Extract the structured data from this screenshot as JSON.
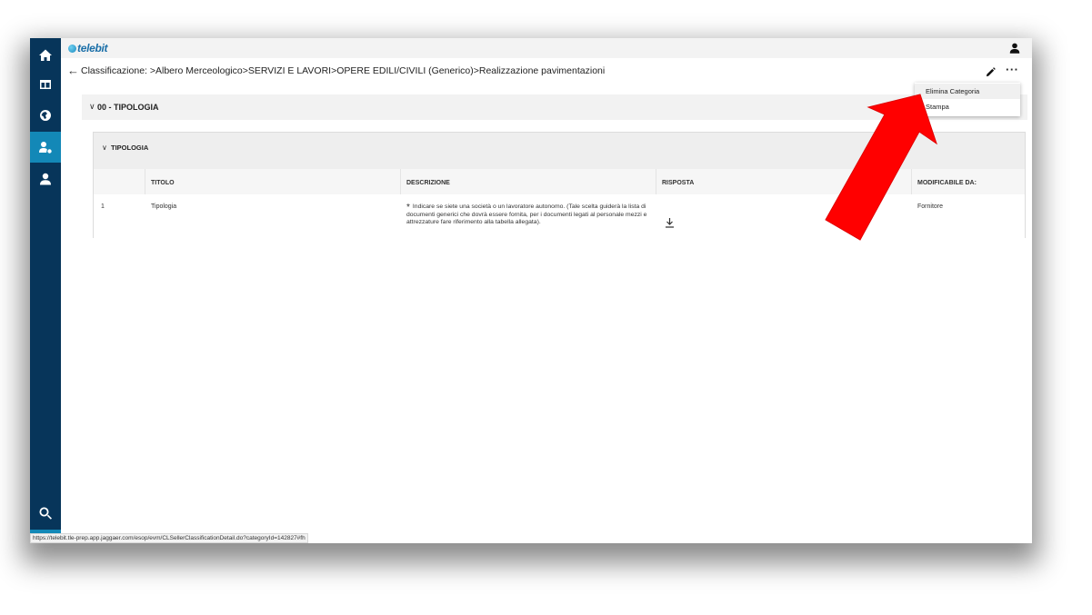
{
  "app": {
    "logo_text": "telebit"
  },
  "sidebar": {
    "items": [
      {
        "name": "home",
        "icon": "home-icon"
      },
      {
        "name": "dashboard",
        "icon": "layout-icon"
      },
      {
        "name": "globe",
        "icon": "globe-icon"
      },
      {
        "name": "supplier",
        "icon": "user-settings-icon",
        "active": true
      },
      {
        "name": "profile",
        "icon": "user-icon"
      },
      {
        "name": "search",
        "icon": "search-icon"
      }
    ]
  },
  "breadcrumb": {
    "text": "Classificazione: >Albero Merceologico>SERVIZI E LAVORI>OPERE EDILI/CIVILI (Generico)>Realizzazione pavimentazioni"
  },
  "section": {
    "title": "00 - TIPOLOGIA"
  },
  "subsection": {
    "title": "TIPOLOGIA",
    "columns": [
      "TITOLO",
      "DESCRIZIONE",
      "RISPOSTA",
      "MODIFICABILE DA:"
    ],
    "rows": [
      {
        "index": "1",
        "titolo": "Tipologia",
        "asterisk": "*",
        "descrizione": "Indicare se siete una società o un lavoratore autonomo. (Tale scelta guiderà la lista di documenti generici che dovrà essere fornita, per i documenti legati al personale mezzi e attrezzature fare riferimento alla tabella allegata).",
        "modificabile_da": "Fornitore"
      }
    ]
  },
  "menu": {
    "items": [
      "Elimina Categoria",
      "Stampa"
    ]
  },
  "status_bar": {
    "url": "https://telebit.tle-prep.app.jaggaer.com/esop/evm/CLSellerClassificationDetail.do?categoryId=142827#fh"
  },
  "colors": {
    "sidebar_bg": "#07355a",
    "sidebar_active": "#1388b7",
    "annotation_arrow": "#ff0000"
  }
}
